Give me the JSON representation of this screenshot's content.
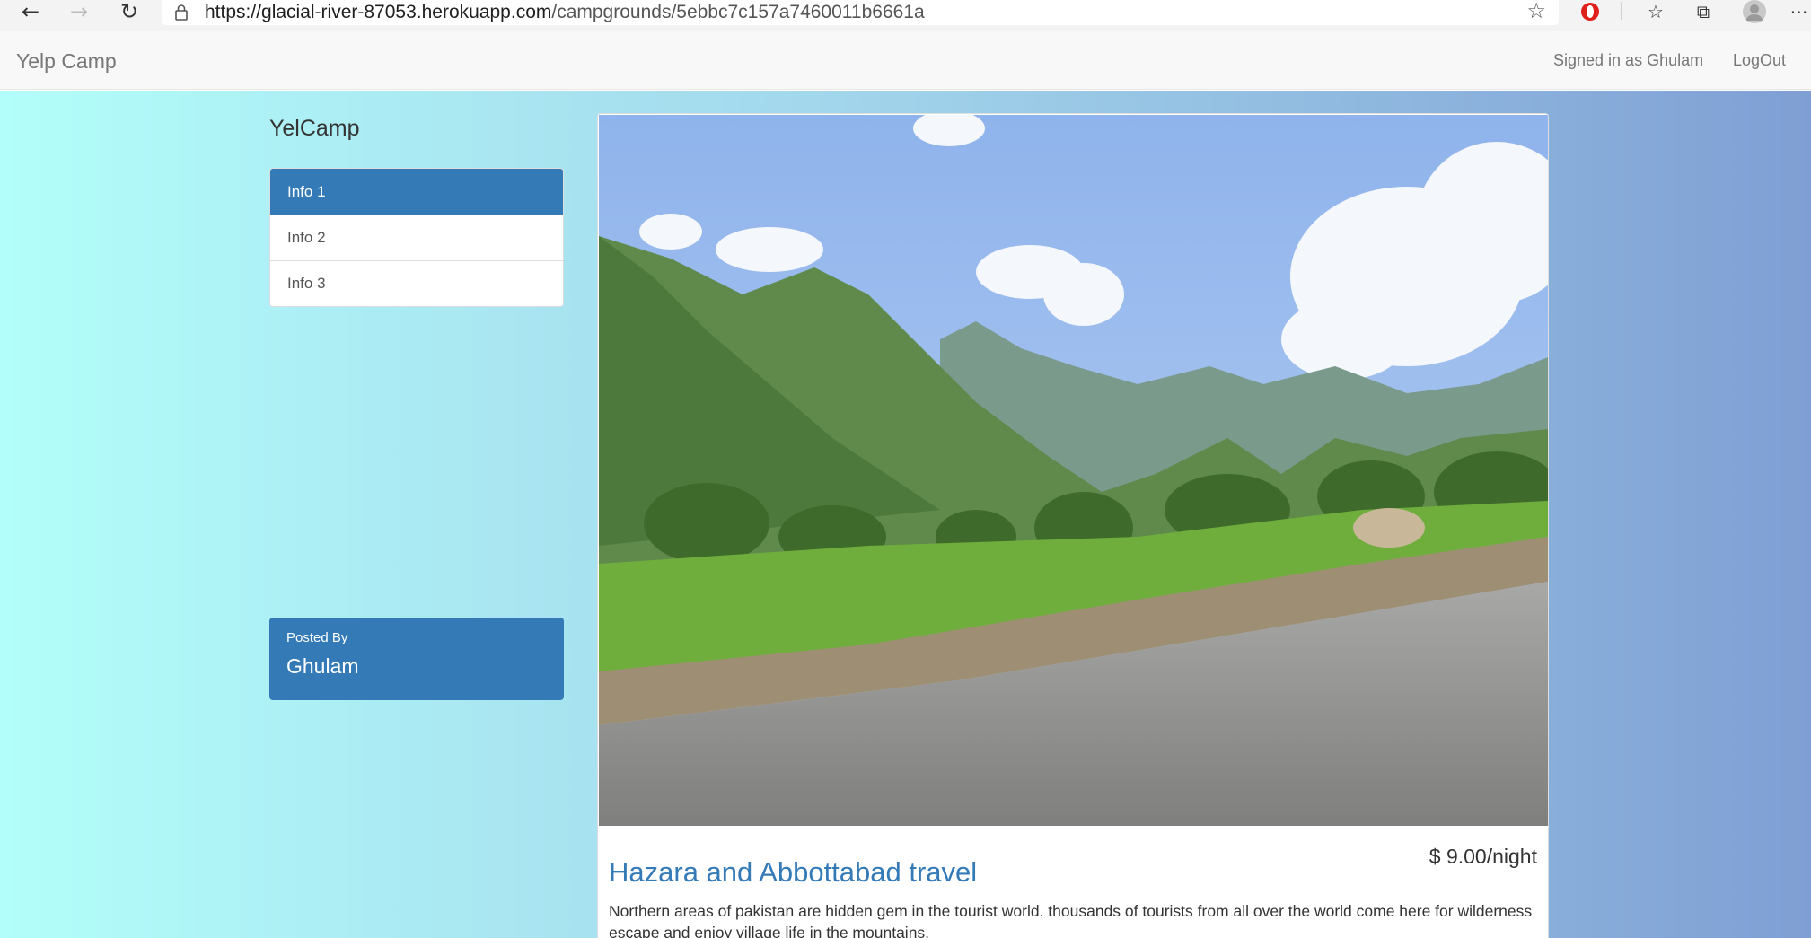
{
  "browser": {
    "url_host": "https://glacial-river-87053.herokuapp.com",
    "url_path": "/campgrounds/5ebbc7c157a7460011b6661a",
    "icons": [
      "back-arrow-icon",
      "forward-arrow-icon",
      "refresh-icon",
      "lock-icon",
      "star-icon",
      "opera-extension-icon",
      "favorites-icon",
      "collections-icon",
      "profile-icon",
      "more-icon"
    ]
  },
  "navbar": {
    "brand": "Yelp Camp",
    "signed_in": "Signed in as Ghulam",
    "logout": "LogOut"
  },
  "sidebar": {
    "title": "YelCamp",
    "items": [
      {
        "label": "Info 1",
        "active": true
      },
      {
        "label": "Info 2",
        "active": false
      },
      {
        "label": "Info 3",
        "active": false
      }
    ],
    "posted_by_label": "Posted By",
    "posted_by_name": "Ghulam"
  },
  "campground": {
    "title": "Hazara and Abbottabad travel",
    "price": "$ 9.00/night",
    "description": "Northern areas of pakistan are hidden gem in the tourist world. thousands of tourists from all over the world come here for wilderness escape and enjoy village life in the mountains."
  },
  "colors": {
    "primary": "#337ab7",
    "gradient_left": "#b2fefa",
    "gradient_right": "#7f9fd4"
  }
}
